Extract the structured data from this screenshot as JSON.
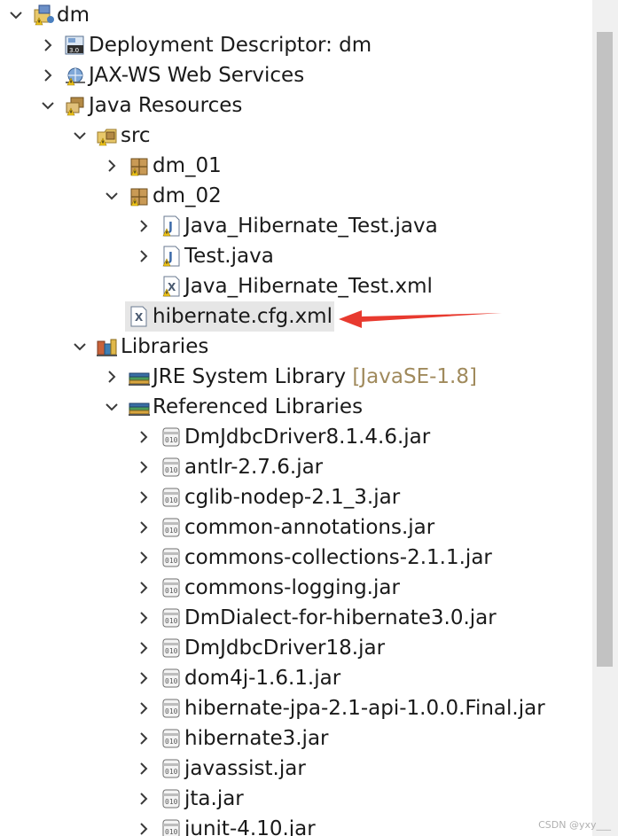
{
  "tree": [
    {
      "label": "dm",
      "expanded": true,
      "icon": "project-icon",
      "depth": 0
    },
    {
      "label": "Deployment Descriptor: dm",
      "expanded": false,
      "icon": "deployment-descriptor-icon",
      "depth": 1
    },
    {
      "label": "JAX-WS Web Services",
      "expanded": false,
      "icon": "web-services-icon",
      "depth": 1
    },
    {
      "label": "Java Resources",
      "expanded": true,
      "icon": "java-resources-icon",
      "depth": 1
    },
    {
      "label": "src",
      "expanded": true,
      "icon": "source-folder-icon",
      "depth": 2
    },
    {
      "label": "dm_01",
      "expanded": false,
      "icon": "package-icon",
      "depth": 3
    },
    {
      "label": "dm_02",
      "expanded": true,
      "icon": "package-icon",
      "depth": 3
    },
    {
      "label": "Java_Hibernate_Test.java",
      "expanded": false,
      "icon": "java-file-warning-icon",
      "depth": 4
    },
    {
      "label": "Test.java",
      "expanded": false,
      "icon": "java-file-warning-icon",
      "depth": 4
    },
    {
      "label": "Java_Hibernate_Test.xml",
      "leaf": true,
      "icon": "xml-file-warning-icon",
      "depth": 4
    },
    {
      "label": "hibernate.cfg.xml",
      "leaf": true,
      "icon": "xml-file-icon",
      "depth": 3,
      "selected": true
    },
    {
      "label": "Libraries",
      "expanded": true,
      "icon": "libraries-icon",
      "depth": 2
    },
    {
      "label": "JRE System Library",
      "decoration": "[JavaSE-1.8]",
      "expanded": false,
      "icon": "library-icon",
      "depth": 3
    },
    {
      "label": "Referenced Libraries",
      "expanded": true,
      "icon": "library-icon",
      "depth": 3
    },
    {
      "label": "DmJdbcDriver8.1.4.6.jar",
      "expanded": false,
      "icon": "jar-icon",
      "depth": 4
    },
    {
      "label": "antlr-2.7.6.jar",
      "expanded": false,
      "icon": "jar-icon",
      "depth": 4
    },
    {
      "label": "cglib-nodep-2.1_3.jar",
      "expanded": false,
      "icon": "jar-icon",
      "depth": 4
    },
    {
      "label": "common-annotations.jar",
      "expanded": false,
      "icon": "jar-icon",
      "depth": 4
    },
    {
      "label": "commons-collections-2.1.1.jar",
      "expanded": false,
      "icon": "jar-icon",
      "depth": 4
    },
    {
      "label": "commons-logging.jar",
      "expanded": false,
      "icon": "jar-icon",
      "depth": 4
    },
    {
      "label": "DmDialect-for-hibernate3.0.jar",
      "expanded": false,
      "icon": "jar-icon",
      "depth": 4
    },
    {
      "label": "DmJdbcDriver18.jar",
      "expanded": false,
      "icon": "jar-icon",
      "depth": 4
    },
    {
      "label": "dom4j-1.6.1.jar",
      "expanded": false,
      "icon": "jar-icon",
      "depth": 4
    },
    {
      "label": "hibernate-jpa-2.1-api-1.0.0.Final.jar",
      "expanded": false,
      "icon": "jar-icon",
      "depth": 4
    },
    {
      "label": "hibernate3.jar",
      "expanded": false,
      "icon": "jar-icon",
      "depth": 4
    },
    {
      "label": "javassist.jar",
      "expanded": false,
      "icon": "jar-icon",
      "depth": 4
    },
    {
      "label": "jta.jar",
      "expanded": false,
      "icon": "jar-icon",
      "depth": 4
    },
    {
      "label": "junit-4.10.jar",
      "expanded": false,
      "icon": "jar-icon",
      "depth": 4
    }
  ],
  "annotation": {
    "type": "arrow",
    "color": "#e83a2f",
    "points_to": "hibernate.cfg.xml"
  },
  "watermark": "CSDN @yxy___"
}
